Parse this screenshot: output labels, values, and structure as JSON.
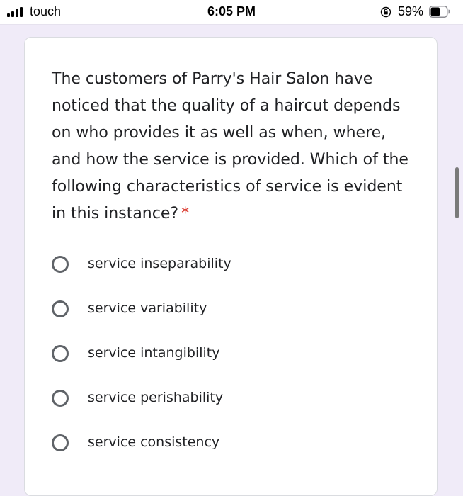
{
  "status_bar": {
    "carrier": "touch",
    "time": "6:05 PM",
    "battery_percent": "59%",
    "battery_level": 0.59,
    "icons": [
      "signal-bars-icon",
      "orientation-lock-icon",
      "battery-icon"
    ]
  },
  "form": {
    "question": "The customers of Parry's Hair Salon have noticed that the quality of a haircut depends on who provides it as well as when, where, and how the service is provided. Which of the following characteristics of service is evident in this instance?",
    "required_marker": "*",
    "options": [
      {
        "label": "service inseparability"
      },
      {
        "label": "service variability"
      },
      {
        "label": "service intangibility"
      },
      {
        "label": "service perishability"
      },
      {
        "label": "service consistency"
      }
    ]
  },
  "colors": {
    "page_background": "#f0ebf8",
    "card_background": "#ffffff",
    "required": "#d93025",
    "radio_border": "#5f6368",
    "text": "#202124"
  }
}
